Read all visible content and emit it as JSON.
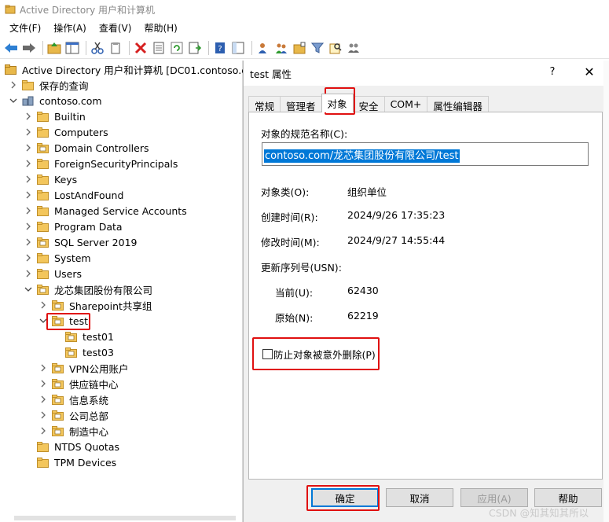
{
  "window": {
    "title": "Active Directory 用户和计算机"
  },
  "menu": [
    "文件(F)",
    "操作(A)",
    "查看(V)",
    "帮助(H)"
  ],
  "tree": {
    "root": "Active Directory 用户和计算机 [DC01.contoso.cor",
    "saved_queries": "保存的查询",
    "domain": "contoso.com",
    "items": [
      "Builtin",
      "Computers",
      "Domain Controllers",
      "ForeignSecurityPrincipals",
      "Keys",
      "LostAndFound",
      "Managed Service Accounts",
      "Program Data",
      "SQL Server 2019",
      "System",
      "Users",
      "龙芯集团股份有限公司",
      "Sharepoint共享组",
      "test",
      "test01",
      "test03",
      "VPN公用账户",
      "供应链中心",
      "信息系统",
      "公司总部",
      "制造中心",
      "NTDS Quotas",
      "TPM Devices"
    ]
  },
  "dialog": {
    "title": "test 属性",
    "help": "?",
    "close": "✕",
    "tabs": [
      "常规",
      "管理者",
      "对象",
      "安全",
      "COM+",
      "属性编辑器"
    ],
    "canonical_label": "对象的规范名称(C):",
    "canonical_value": "contoso.com/龙芯集团股份有限公司/test",
    "object_class_label": "对象类(O):",
    "object_class_value": "组织单位",
    "created_label": "创建时间(R):",
    "created_value": "2024/9/26 17:35:23",
    "modified_label": "修改时间(M):",
    "modified_value": "2024/9/27 14:55:44",
    "usn_label": "更新序列号(USN):",
    "current_label": "当前(U):",
    "current_value": "62430",
    "original_label": "原始(N):",
    "original_value": "62219",
    "protect_label": "防止对象被意外删除(P)",
    "buttons": {
      "ok": "确定",
      "cancel": "取消",
      "apply": "应用(A)",
      "help": "帮助"
    }
  },
  "watermark": "CSDN @知其知其所以",
  "colors": {
    "highlight": "#e01010",
    "selection": "#0078d7",
    "folder": "#e8b84a"
  }
}
